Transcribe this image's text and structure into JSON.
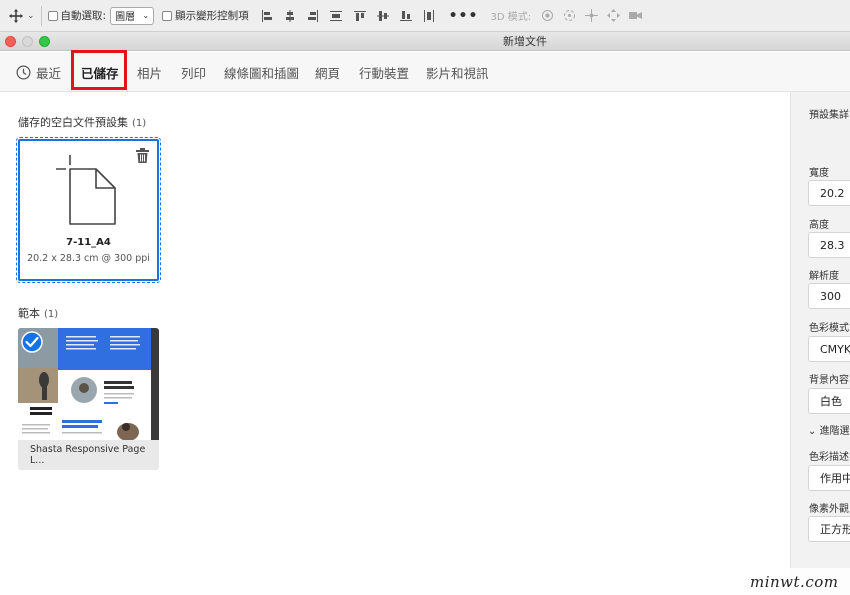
{
  "toolbar": {
    "auto_select_label": "自動選取:",
    "auto_select_value": "圖層",
    "transform_label": "顯示變形控制項",
    "mode_3d_label": "3D 模式:"
  },
  "window": {
    "title": "新增文件"
  },
  "tabs": [
    {
      "label": "最近"
    },
    {
      "label": "已儲存"
    },
    {
      "label": "相片"
    },
    {
      "label": "列印"
    },
    {
      "label": "線條圖和插圖"
    },
    {
      "label": "網頁"
    },
    {
      "label": "行動裝置"
    },
    {
      "label": "影片和視訊"
    }
  ],
  "active_tab": "已儲存",
  "saved_section": {
    "title": "儲存的空白文件預設集",
    "count": "(1)",
    "preset": {
      "name": "7-11_A4",
      "size": "20.2 x 28.3 cm @ 300 ppi"
    }
  },
  "template_section": {
    "title": "範本",
    "count": "(1)",
    "template": {
      "name": "Shasta Responsive Page L..."
    }
  },
  "right_panel": {
    "header": "預設集詳",
    "width_label": "寬度",
    "width_value": "20.2",
    "height_label": "高度",
    "height_value": "28.3",
    "resolution_label": "解析度",
    "resolution_value": "300",
    "color_mode_label": "色彩模式",
    "color_mode_value": "CMYK",
    "background_label": "背景內容",
    "background_value": "白色",
    "advanced_label": "進階選",
    "color_profile_label": "色彩描述",
    "color_profile_value": "作用中",
    "pixel_aspect_label": "像素外觀",
    "pixel_aspect_value": "正方形"
  },
  "watermark": "minwt.com",
  "colors": {
    "accent": "#1473e6",
    "highlight": "#e5121c"
  }
}
